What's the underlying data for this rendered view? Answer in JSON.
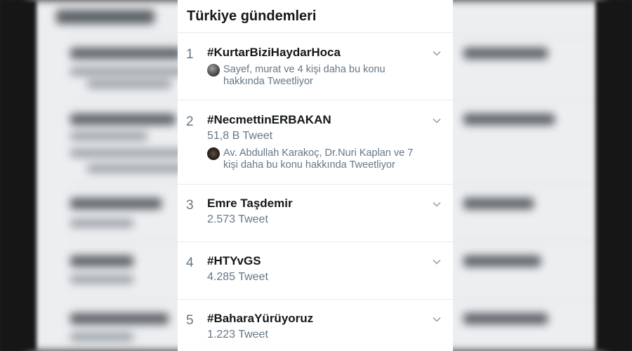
{
  "panel": {
    "title": "Türkiye gündemleri"
  },
  "trends": [
    {
      "rank": "1",
      "name": "#KurtarBiziHaydarHoca",
      "count": "",
      "context": "Sayef, murat ve 4 kişi daha bu konu hakkında Tweetliyor"
    },
    {
      "rank": "2",
      "name": "#NecmettinERBAKAN",
      "count": "51,8 B Tweet",
      "context": "Av. Abdullah Karakoç, Dr.Nuri Kaplan ve 7 kişi daha bu konu hakkında Tweetliyor"
    },
    {
      "rank": "3",
      "name": "Emre Taşdemir",
      "count": "2.573 Tweet",
      "context": ""
    },
    {
      "rank": "4",
      "name": "#HTYvGS",
      "count": "4.285 Tweet",
      "context": ""
    },
    {
      "rank": "5",
      "name": "#BaharaYürüyoruz",
      "count": "1.223 Tweet",
      "context": ""
    }
  ],
  "icons": {
    "chevron": "chevron-down-icon",
    "avatar": "user-avatar"
  },
  "colors": {
    "text_primary": "#14171a",
    "text_secondary": "#657786",
    "divider": "#e6ecf0"
  }
}
